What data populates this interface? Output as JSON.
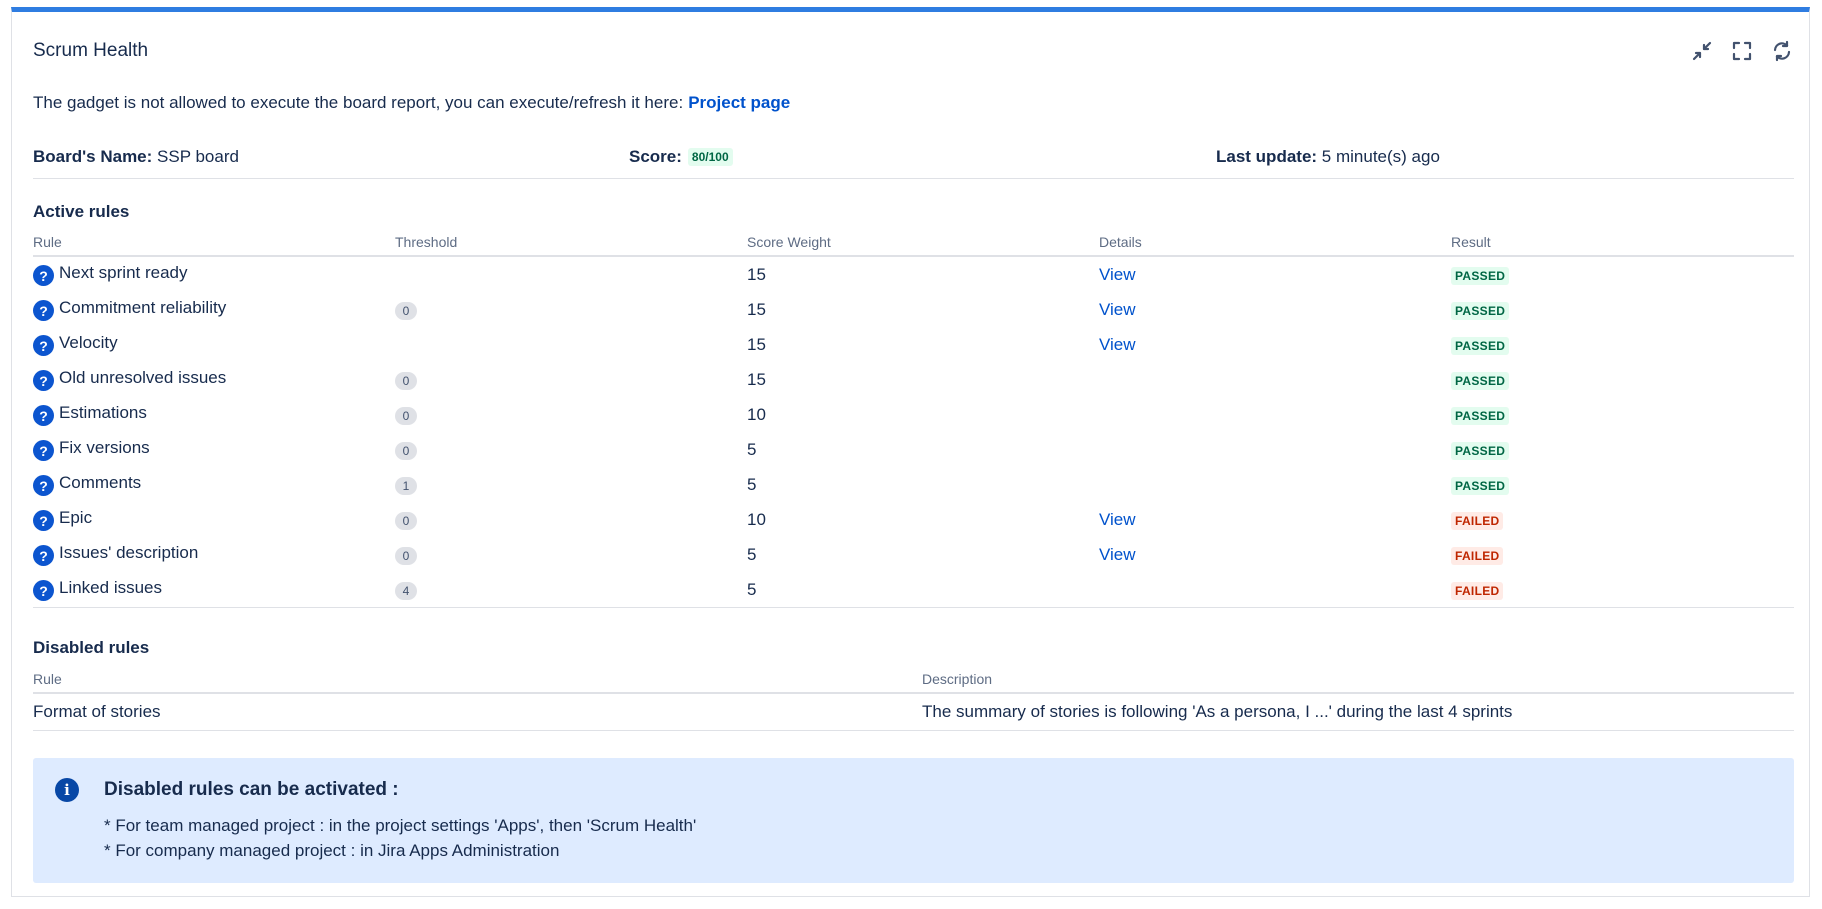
{
  "gadget": {
    "title": "Scrum Health",
    "controls": [
      "minimize-icon",
      "fullscreen-icon",
      "refresh-icon"
    ],
    "notice_text": "The gadget is not allowed to execute the board report, you can execute/refresh it here:",
    "notice_link": "Project page"
  },
  "meta": {
    "board_label": "Board's Name:",
    "board_value": "SSP board",
    "score_label": "Score:",
    "score_value": "80/100",
    "update_label": "Last update:",
    "update_value": "5 minute(s) ago"
  },
  "active_rules": {
    "title": "Active rules",
    "headers": [
      "Rule",
      "Threshold",
      "Score Weight",
      "Details",
      "Result"
    ],
    "rows": [
      {
        "rule": "Next sprint ready",
        "threshold": "",
        "weight": "15",
        "details": "View",
        "result": "PASSED"
      },
      {
        "rule": "Commitment reliability",
        "threshold": "0",
        "weight": "15",
        "details": "View",
        "result": "PASSED"
      },
      {
        "rule": "Velocity",
        "threshold": "",
        "weight": "15",
        "details": "View",
        "result": "PASSED"
      },
      {
        "rule": "Old unresolved issues",
        "threshold": "0",
        "weight": "15",
        "details": "",
        "result": "PASSED"
      },
      {
        "rule": "Estimations",
        "threshold": "0",
        "weight": "10",
        "details": "",
        "result": "PASSED"
      },
      {
        "rule": "Fix versions",
        "threshold": "0",
        "weight": "5",
        "details": "",
        "result": "PASSED"
      },
      {
        "rule": "Comments",
        "threshold": "1",
        "weight": "5",
        "details": "",
        "result": "PASSED"
      },
      {
        "rule": "Epic",
        "threshold": "0",
        "weight": "10",
        "details": "View",
        "result": "FAILED"
      },
      {
        "rule": "Issues' description",
        "threshold": "0",
        "weight": "5",
        "details": "View",
        "result": "FAILED"
      },
      {
        "rule": "Linked issues",
        "threshold": "4",
        "weight": "5",
        "details": "",
        "result": "FAILED"
      }
    ]
  },
  "disabled_rules": {
    "title": "Disabled rules",
    "headers": [
      "Rule",
      "Description"
    ],
    "rows": [
      {
        "rule": "Format of stories",
        "description": "The summary of stories is following 'As a persona, I ...' during the last 4 sprints"
      }
    ]
  },
  "info": {
    "title": "Disabled rules can be activated :",
    "lines": [
      "* For team managed project : in the project settings 'Apps', then 'Scrum Health'",
      "* For company managed project : in Jira Apps Administration"
    ]
  },
  "colors": {
    "accent_bar": "#2f7de1",
    "link": "#0052cc",
    "passed_text": "#006644",
    "passed_bg": "#e3fcef",
    "failed_text": "#bf2600",
    "failed_bg": "#ffebe6",
    "info_bg": "#deebff"
  }
}
